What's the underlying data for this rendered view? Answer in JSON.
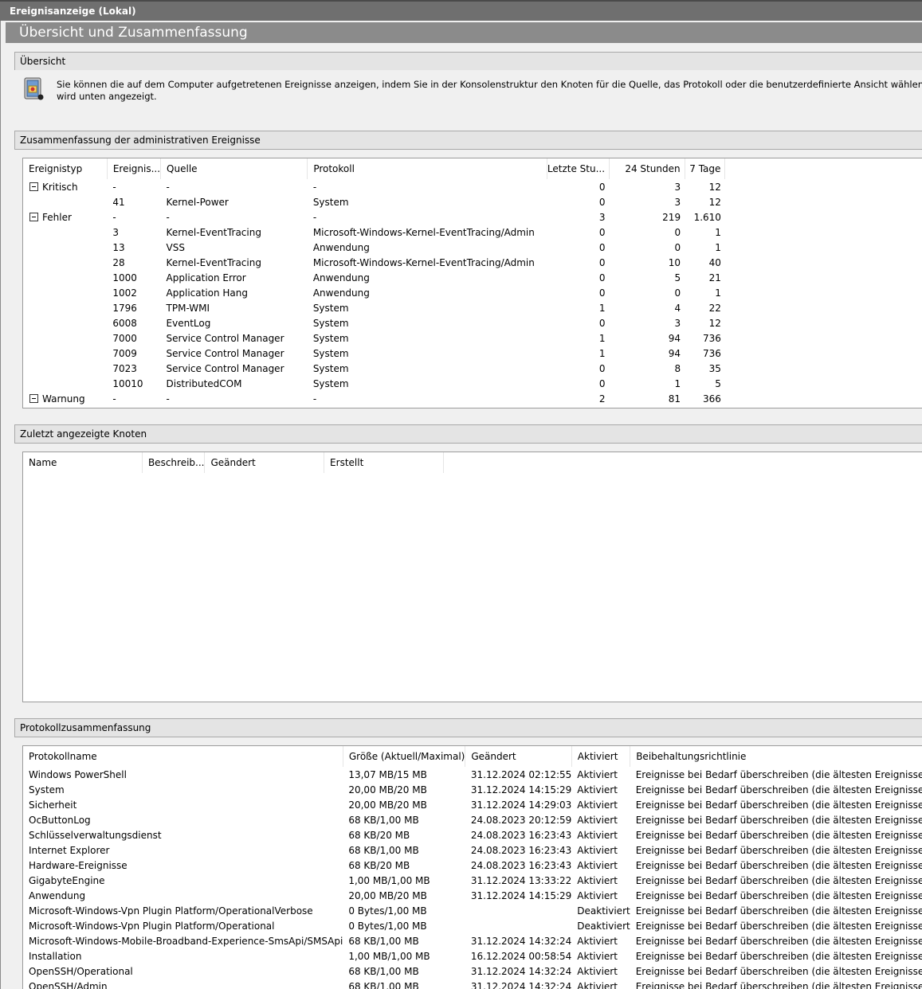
{
  "window": {
    "title": "Ereignisanzeige (Lokal)"
  },
  "main_header": "Übersicht und Zusammenfassung",
  "overview": {
    "title": "Übersicht",
    "icon": "event-viewer-icon",
    "text_line1": "Sie können die auf dem Computer aufgetretenen Ereignisse anzeigen, indem Sie in der Konsolenstruktur den Knoten für die Quelle, das Protokoll oder die benutzerdefinierte Ansicht wählen. Die benutzerdefin",
    "text_line2": "wird unten angezeigt."
  },
  "admin_summary": {
    "title": "Zusammenfassung der administrativen Ereignisse",
    "columns": [
      "Ereignistyp",
      "Ereignis...",
      "Quelle",
      "Protokoll",
      "Letzte Stu...",
      "24 Stunden",
      "7 Tage"
    ],
    "rows": [
      {
        "type": "Kritisch",
        "group": true,
        "id": "-",
        "source": "-",
        "log": "-",
        "hour": "0",
        "day": "3",
        "week": "12"
      },
      {
        "type": "",
        "group": false,
        "id": "41",
        "source": "Kernel-Power",
        "log": "System",
        "hour": "0",
        "day": "3",
        "week": "12"
      },
      {
        "type": "Fehler",
        "group": true,
        "id": "-",
        "source": "-",
        "log": "-",
        "hour": "3",
        "day": "219",
        "week": "1.610"
      },
      {
        "type": "",
        "group": false,
        "id": "3",
        "source": "Kernel-EventTracing",
        "log": "Microsoft-Windows-Kernel-EventTracing/Admin",
        "hour": "0",
        "day": "0",
        "week": "1"
      },
      {
        "type": "",
        "group": false,
        "id": "13",
        "source": "VSS",
        "log": "Anwendung",
        "hour": "0",
        "day": "0",
        "week": "1"
      },
      {
        "type": "",
        "group": false,
        "id": "28",
        "source": "Kernel-EventTracing",
        "log": "Microsoft-Windows-Kernel-EventTracing/Admin",
        "hour": "0",
        "day": "10",
        "week": "40"
      },
      {
        "type": "",
        "group": false,
        "id": "1000",
        "source": "Application Error",
        "log": "Anwendung",
        "hour": "0",
        "day": "5",
        "week": "21"
      },
      {
        "type": "",
        "group": false,
        "id": "1002",
        "source": "Application Hang",
        "log": "Anwendung",
        "hour": "0",
        "day": "0",
        "week": "1"
      },
      {
        "type": "",
        "group": false,
        "id": "1796",
        "source": "TPM-WMI",
        "log": "System",
        "hour": "1",
        "day": "4",
        "week": "22"
      },
      {
        "type": "",
        "group": false,
        "id": "6008",
        "source": "EventLog",
        "log": "System",
        "hour": "0",
        "day": "3",
        "week": "12"
      },
      {
        "type": "",
        "group": false,
        "id": "7000",
        "source": "Service Control Manager",
        "log": "System",
        "hour": "1",
        "day": "94",
        "week": "736"
      },
      {
        "type": "",
        "group": false,
        "id": "7009",
        "source": "Service Control Manager",
        "log": "System",
        "hour": "1",
        "day": "94",
        "week": "736"
      },
      {
        "type": "",
        "group": false,
        "id": "7023",
        "source": "Service Control Manager",
        "log": "System",
        "hour": "0",
        "day": "8",
        "week": "35"
      },
      {
        "type": "",
        "group": false,
        "id": "10010",
        "source": "DistributedCOM",
        "log": "System",
        "hour": "0",
        "day": "1",
        "week": "5"
      },
      {
        "type": "Warnung",
        "group": true,
        "id": "-",
        "source": "-",
        "log": "-",
        "hour": "2",
        "day": "81",
        "week": "366"
      }
    ]
  },
  "recent_nodes": {
    "title": "Zuletzt angezeigte Knoten",
    "columns": [
      "Name",
      "Beschreib...",
      "Geändert",
      "Erstellt"
    ]
  },
  "log_summary": {
    "title": "Protokollzusammenfassung",
    "columns": [
      "Protokollname",
      "Größe (Aktuell/Maximal)",
      "Geändert",
      "Aktiviert",
      "Beibehaltungsrichtlinie"
    ],
    "rows": [
      {
        "name": "Windows PowerShell",
        "size": "13,07 MB/15 MB",
        "modified": "31.12.2024 02:12:55",
        "enabled": "Aktiviert",
        "policy": "Ereignisse bei Bedarf überschreiben (die ältesten Ereignisse zuerst)"
      },
      {
        "name": "System",
        "size": "20,00 MB/20 MB",
        "modified": "31.12.2024 14:15:29",
        "enabled": "Aktiviert",
        "policy": "Ereignisse bei Bedarf überschreiben (die ältesten Ereignisse zuerst)"
      },
      {
        "name": "Sicherheit",
        "size": "20,00 MB/20 MB",
        "modified": "31.12.2024 14:29:03",
        "enabled": "Aktiviert",
        "policy": "Ereignisse bei Bedarf überschreiben (die ältesten Ereignisse zuerst)"
      },
      {
        "name": "OcButtonLog",
        "size": "68 KB/1,00 MB",
        "modified": "24.08.2023 20:12:59",
        "enabled": "Aktiviert",
        "policy": "Ereignisse bei Bedarf überschreiben (die ältesten Ereignisse zuerst)"
      },
      {
        "name": "Schlüsselverwaltungsdienst",
        "size": "68 KB/20 MB",
        "modified": "24.08.2023 16:23:43",
        "enabled": "Aktiviert",
        "policy": "Ereignisse bei Bedarf überschreiben (die ältesten Ereignisse zuerst)"
      },
      {
        "name": "Internet Explorer",
        "size": "68 KB/1,00 MB",
        "modified": "24.08.2023 16:23:43",
        "enabled": "Aktiviert",
        "policy": "Ereignisse bei Bedarf überschreiben (die ältesten Ereignisse zuerst)"
      },
      {
        "name": "Hardware-Ereignisse",
        "size": "68 KB/20 MB",
        "modified": "24.08.2023 16:23:43",
        "enabled": "Aktiviert",
        "policy": "Ereignisse bei Bedarf überschreiben (die ältesten Ereignisse zuerst)"
      },
      {
        "name": "GigabyteEngine",
        "size": "1,00 MB/1,00 MB",
        "modified": "31.12.2024 13:33:22",
        "enabled": "Aktiviert",
        "policy": "Ereignisse bei Bedarf überschreiben (die ältesten Ereignisse zuerst)"
      },
      {
        "name": "Anwendung",
        "size": "20,00 MB/20 MB",
        "modified": "31.12.2024 14:15:29",
        "enabled": "Aktiviert",
        "policy": "Ereignisse bei Bedarf überschreiben (die ältesten Ereignisse zuerst)"
      },
      {
        "name": "Microsoft-Windows-Vpn Plugin Platform/OperationalVerbose",
        "size": "0 Bytes/1,00 MB",
        "modified": "",
        "enabled": "Deaktiviert",
        "policy": "Ereignisse bei Bedarf überschreiben (die ältesten Ereignisse zuerst)"
      },
      {
        "name": "Microsoft-Windows-Vpn Plugin Platform/Operational",
        "size": "0 Bytes/1,00 MB",
        "modified": "",
        "enabled": "Deaktiviert",
        "policy": "Ereignisse bei Bedarf überschreiben (die ältesten Ereignisse zuerst)"
      },
      {
        "name": "Microsoft-Windows-Mobile-Broadband-Experience-SmsApi/SMSApi",
        "size": "68 KB/1,00 MB",
        "modified": "31.12.2024 14:32:24",
        "enabled": "Aktiviert",
        "policy": "Ereignisse bei Bedarf überschreiben (die ältesten Ereignisse zuerst)"
      },
      {
        "name": "Installation",
        "size": "1,00 MB/1,00 MB",
        "modified": "16.12.2024 00:58:54",
        "enabled": "Aktiviert",
        "policy": "Ereignisse bei Bedarf überschreiben (die ältesten Ereignisse zuerst)"
      },
      {
        "name": "OpenSSH/Operational",
        "size": "68 KB/1,00 MB",
        "modified": "31.12.2024 14:32:24",
        "enabled": "Aktiviert",
        "policy": "Ereignisse bei Bedarf überschreiben (die ältesten Ereignisse zuerst)"
      },
      {
        "name": "OpenSSH/Admin",
        "size": "68 KB/1,00 MB",
        "modified": "31.12.2024 14:32:24",
        "enabled": "Aktiviert",
        "policy": "Ereignisse bei Bedarf überschreiben (die ältesten Ereignisse zuerst)"
      }
    ]
  }
}
